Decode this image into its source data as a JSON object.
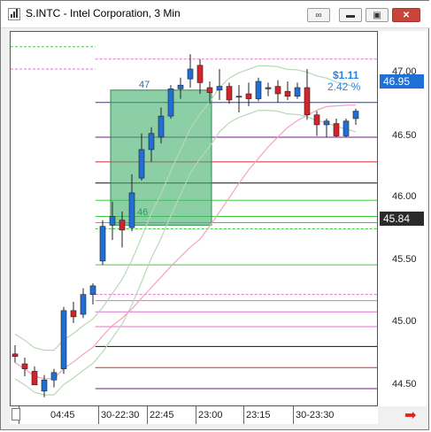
{
  "window": {
    "title": "S.INTC - Intel Corporation, 3 Min",
    "buttons": [
      {
        "name": "link-icon",
        "glyph": "∞"
      },
      {
        "name": "minimize",
        "glyph": "▬"
      },
      {
        "name": "maximize",
        "glyph": "▣"
      },
      {
        "name": "close",
        "glyph": "✕"
      }
    ]
  },
  "price_axis": {
    "ticks": [
      "47.00",
      "46.50",
      "46.00",
      "45.50",
      "45.00",
      "44.50"
    ],
    "last_price": "46.95",
    "ref_price": "45.84"
  },
  "time_axis": {
    "labels": [
      "04:45",
      "30-22:30",
      "22:45",
      "23:00",
      "23:15",
      "30-23:30"
    ]
  },
  "measure_box": {
    "top_label": "47",
    "bottom_label": "46",
    "change": "$1.11",
    "change_pct": "2.42 %"
  },
  "colors": {
    "up": "#1f6fd6",
    "down": "#d4242a",
    "box": "#3fae6b",
    "last_tag": "#1f6fd6",
    "ref_tag": "#2b2b2b"
  },
  "chart_data": {
    "type": "candlestick",
    "symbol": "S.INTC",
    "interval": "3 Min",
    "ylim": [
      44.37,
      47.4
    ],
    "candles": [
      {
        "o": 44.8,
        "h": 44.87,
        "l": 44.73,
        "c": 44.78
      },
      {
        "o": 44.72,
        "h": 44.77,
        "l": 44.62,
        "c": 44.68
      },
      {
        "o": 44.66,
        "h": 44.7,
        "l": 44.57,
        "c": 44.55
      },
      {
        "o": 44.5,
        "h": 44.63,
        "l": 44.45,
        "c": 44.59
      },
      {
        "o": 44.59,
        "h": 44.68,
        "l": 44.53,
        "c": 44.65
      },
      {
        "o": 44.68,
        "h": 45.18,
        "l": 44.64,
        "c": 45.15
      },
      {
        "o": 45.15,
        "h": 45.22,
        "l": 45.05,
        "c": 45.1
      },
      {
        "o": 45.12,
        "h": 45.33,
        "l": 45.09,
        "c": 45.28
      },
      {
        "o": 45.28,
        "h": 45.37,
        "l": 45.2,
        "c": 45.35
      },
      {
        "o": 45.55,
        "h": 45.88,
        "l": 45.52,
        "c": 45.83
      },
      {
        "o": 45.84,
        "h": 46.03,
        "l": 45.72,
        "c": 45.91
      },
      {
        "o": 45.88,
        "h": 45.95,
        "l": 45.66,
        "c": 45.8
      },
      {
        "o": 45.82,
        "h": 46.25,
        "l": 45.79,
        "c": 46.1
      },
      {
        "o": 46.22,
        "h": 46.58,
        "l": 46.2,
        "c": 46.45
      },
      {
        "o": 46.45,
        "h": 46.63,
        "l": 46.35,
        "c": 46.58
      },
      {
        "o": 46.55,
        "h": 46.79,
        "l": 46.5,
        "c": 46.72
      },
      {
        "o": 46.72,
        "h": 46.97,
        "l": 46.7,
        "c": 46.94
      },
      {
        "o": 46.94,
        "h": 47.03,
        "l": 46.86,
        "c": 46.97
      },
      {
        "o": 47.02,
        "h": 47.22,
        "l": 46.95,
        "c": 47.1
      },
      {
        "o": 47.13,
        "h": 47.18,
        "l": 46.9,
        "c": 46.99
      },
      {
        "o": 46.95,
        "h": 47.0,
        "l": 46.82,
        "c": 46.91
      },
      {
        "o": 46.93,
        "h": 47.1,
        "l": 46.85,
        "c": 46.96
      },
      {
        "o": 46.96,
        "h": 46.99,
        "l": 46.82,
        "c": 46.85
      },
      {
        "o": 46.88,
        "h": 46.97,
        "l": 46.75,
        "c": 46.88
      },
      {
        "o": 46.9,
        "h": 46.99,
        "l": 46.8,
        "c": 46.86
      },
      {
        "o": 46.86,
        "h": 47.03,
        "l": 46.84,
        "c": 47.0
      },
      {
        "o": 46.95,
        "h": 46.99,
        "l": 46.88,
        "c": 46.94
      },
      {
        "o": 46.96,
        "h": 47.01,
        "l": 46.83,
        "c": 46.9
      },
      {
        "o": 46.92,
        "h": 47.0,
        "l": 46.85,
        "c": 46.88
      },
      {
        "o": 46.88,
        "h": 46.99,
        "l": 46.86,
        "c": 46.95
      },
      {
        "o": 46.95,
        "h": 47.1,
        "l": 46.69,
        "c": 46.73
      },
      {
        "o": 46.73,
        "h": 46.76,
        "l": 46.56,
        "c": 46.65
      },
      {
        "o": 46.65,
        "h": 46.7,
        "l": 46.55,
        "c": 46.68
      },
      {
        "o": 46.66,
        "h": 46.7,
        "l": 46.55,
        "c": 46.56
      },
      {
        "o": 46.56,
        "h": 46.7,
        "l": 46.55,
        "c": 46.68
      },
      {
        "o": 46.7,
        "h": 46.78,
        "l": 46.65,
        "c": 46.76
      }
    ],
    "levels": [
      {
        "price": 47.18,
        "color": "#e06fd0",
        "style": "dashed",
        "from": 0.23
      },
      {
        "price": 47.28,
        "color": "#4cc94c",
        "style": "dashed",
        "to": 0.23
      },
      {
        "price": 47.1,
        "color": "#e06fd0",
        "style": "dashed",
        "to": 0.23
      },
      {
        "price": 46.83,
        "color": "#1a3fc7",
        "style": "solid"
      },
      {
        "price": 46.55,
        "color": "#7a1a8a",
        "style": "solid"
      },
      {
        "price": 46.35,
        "color": "#d42a2a",
        "style": "solid"
      },
      {
        "price": 46.18,
        "color": "#111111",
        "style": "solid"
      },
      {
        "price": 46.04,
        "color": "#3ccf3c",
        "style": "solid"
      },
      {
        "price": 45.91,
        "color": "#3ccf3c",
        "style": "solid"
      },
      {
        "price": 45.86,
        "color": "#3ccf3c",
        "style": "solid"
      },
      {
        "price": 45.81,
        "color": "#3ccf3c",
        "style": "dashed"
      },
      {
        "price": 45.52,
        "color": "#3ccf3c",
        "style": "solid"
      },
      {
        "price": 45.28,
        "color": "#e06fd0",
        "style": "dashed"
      },
      {
        "price": 45.23,
        "color": "#e06fd0",
        "style": "solid"
      },
      {
        "price": 45.14,
        "color": "#e06fd0",
        "style": "solid"
      },
      {
        "price": 45.02,
        "color": "#e06fd0",
        "style": "solid"
      },
      {
        "price": 44.86,
        "color": "#111111",
        "style": "solid"
      },
      {
        "price": 44.69,
        "color": "#d42a2a",
        "style": "solid"
      },
      {
        "price": 44.52,
        "color": "#7a1a8a",
        "style": "solid"
      }
    ]
  }
}
